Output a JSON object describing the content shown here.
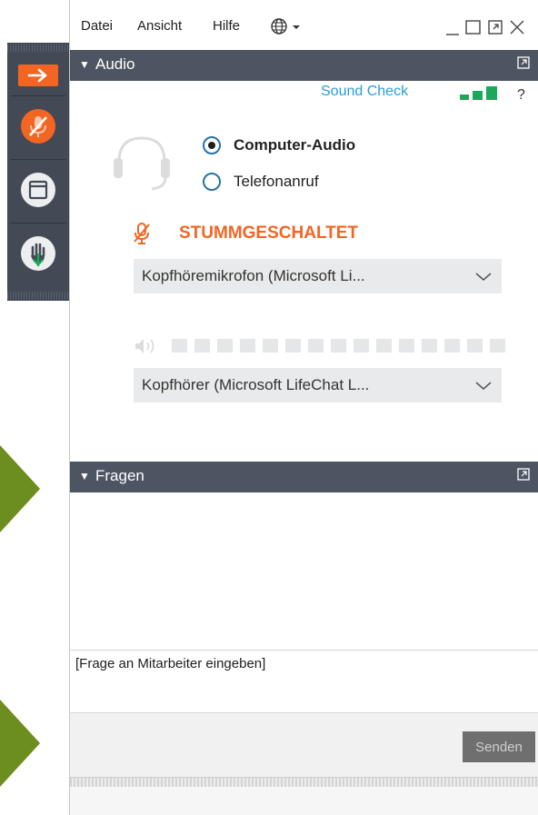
{
  "menu": {
    "file": "Datei",
    "view": "Ansicht",
    "help": "Hilfe"
  },
  "audio": {
    "section_title": "Audio",
    "sound_check": "Sound Check",
    "help_mark": "?",
    "option_computer": "Computer-Audio",
    "option_phone": "Telefonanruf",
    "selected_option": "Computer-Audio",
    "mute_status": "STUMMGESCHALTET",
    "microphone": "Kopfhöremikrofon  (Microsoft Li...",
    "speaker": "Kopfhörer (Microsoft  LifeChat L...",
    "speaker_level": 0,
    "mic_signal_bars": 3,
    "colors": {
      "accent_orange": "#f26522",
      "signal_green": "#1aa95b",
      "link_blue": "#2b9ed6",
      "header_bar": "#4d5563"
    }
  },
  "questions": {
    "section_title": "Fragen",
    "input_placeholder": "[Frage an Mitarbeiter eingeben]",
    "send_label": "Senden"
  },
  "icons": {
    "toolbar": [
      "arrow-right-icon",
      "microphone-muted-icon",
      "window-icon",
      "raise-hand-icon"
    ],
    "menu": [
      "globe-icon"
    ],
    "window": [
      "minimize-icon",
      "maximize-icon",
      "restore-icon",
      "close-icon"
    ]
  }
}
